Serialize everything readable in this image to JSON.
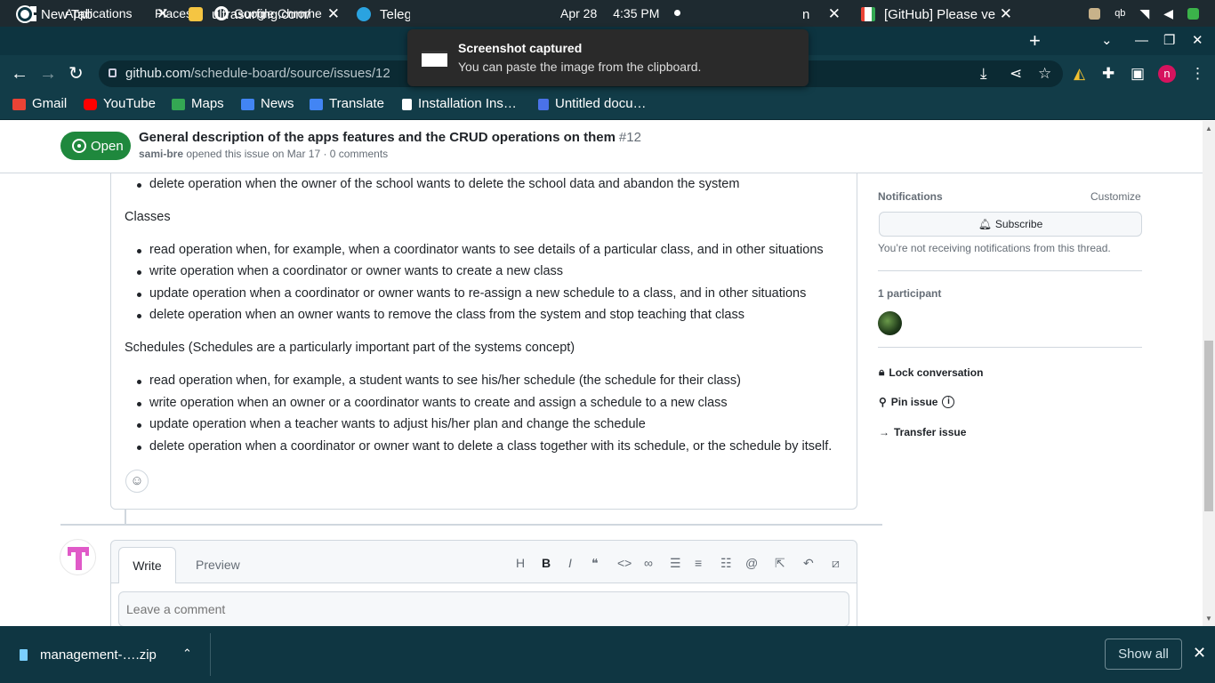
{
  "system": {
    "applications": "Applications",
    "places": "Places",
    "active_app": "Google Chrome",
    "date": "Apr 28",
    "time": "4:35 PM",
    "tray_qb": "qb"
  },
  "tabs": [
    {
      "title": "New Tab",
      "close": "✕"
    },
    {
      "title": "ultrasurfing.com/",
      "close": "✕"
    },
    {
      "title": "Teleg",
      "close": ""
    },
    {
      "title": "n",
      "close": "✕"
    },
    {
      "title": "[GitHub] Please ve",
      "close": "✕"
    }
  ],
  "toolbar": {
    "new_tab": "+",
    "url_host": "github.com",
    "url_path": "/schedule-board/source/issues/12",
    "profile_initial": "n"
  },
  "bookmarks": [
    "Gmail",
    "YouTube",
    "Maps",
    "News",
    "Translate",
    "Installation Ins…",
    "Untitled docu…"
  ],
  "toast": {
    "title": "Screenshot captured",
    "message": "You can paste the image from the clipboard."
  },
  "issue": {
    "state": "Open",
    "title": "General description of the apps features and the CRUD operations on them",
    "number": "#12",
    "author": "sami-bre",
    "meta": "opened this issue on Mar 17 · 0 comments"
  },
  "comment": {
    "top_bullet": "delete operation when the owner of the school wants to delete the school data and abandon the system",
    "sections": [
      {
        "heading": "Classes",
        "bullets": [
          "read operation when, for example, when a coordinator wants to see details of a particular class, and in other situations",
          "write operation when a coordinator or owner wants to create a new class",
          "update operation when a coordinator or owner wants to re-assign a new schedule to a class, and in other situations",
          "delete operation when an owner wants to remove the class from the system and stop teaching that class"
        ]
      },
      {
        "heading": "Schedules (Schedules are a particularly important part of the systems concept)",
        "bullets": [
          "read operation when, for example, a student wants to see his/her schedule (the schedule for their class)",
          "write operation when an owner or a coordinator wants to create and assign a schedule to a new class",
          "update operation when a teacher wants to adjust his/her plan and change the schedule",
          "delete operation when a coordinator or owner want to delete a class together with its schedule, or the schedule by itself."
        ]
      }
    ]
  },
  "editor": {
    "write_tab": "Write",
    "preview_tab": "Preview",
    "placeholder": "Leave a comment"
  },
  "sidebar": {
    "notifications": "Notifications",
    "customize": "Customize",
    "subscribe": "Subscribe",
    "note": "You’re not receiving notifications from this thread.",
    "participants": "1 participant",
    "lock": "Lock conversation",
    "pin": "Pin issue",
    "transfer": "Transfer issue"
  },
  "downloads": {
    "file": "management-….zip",
    "show_all": "Show all"
  }
}
